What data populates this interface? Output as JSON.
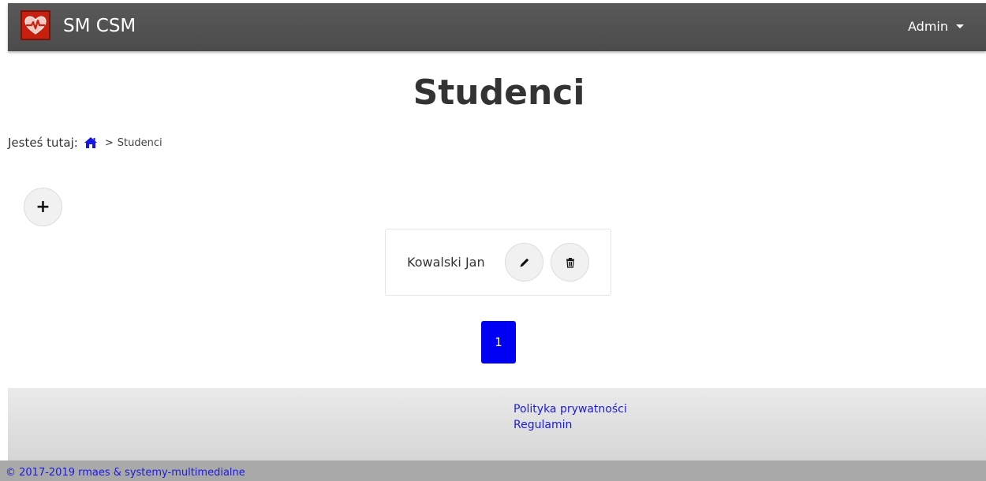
{
  "navbar": {
    "brand": "SM CSM",
    "user_menu": "Admin"
  },
  "main": {
    "title": "Studenci",
    "breadcrumb": {
      "prefix": "Jesteś tutaj:",
      "separator": ">",
      "current": "Studenci"
    },
    "students": [
      {
        "name": "Kowalski Jan"
      }
    ],
    "pagination": {
      "current_page": "1"
    }
  },
  "footer": {
    "links": [
      "Polityka prywatności",
      "Regulamin"
    ],
    "copyright": "© 2017-2019 rmaes & systemy-multimedialne"
  },
  "icons": {
    "logo": "heart-pulse-icon",
    "home": "home-icon",
    "add": "plus-icon",
    "edit": "pencil-icon",
    "delete": "trash-icon",
    "dropdown": "caret-down-icon"
  },
  "colors": {
    "navbar": "#525252",
    "logo": "#c8200f",
    "link": "#1a1adf",
    "pagination_active": "#0000f5",
    "home_icon": "#1515e6"
  }
}
